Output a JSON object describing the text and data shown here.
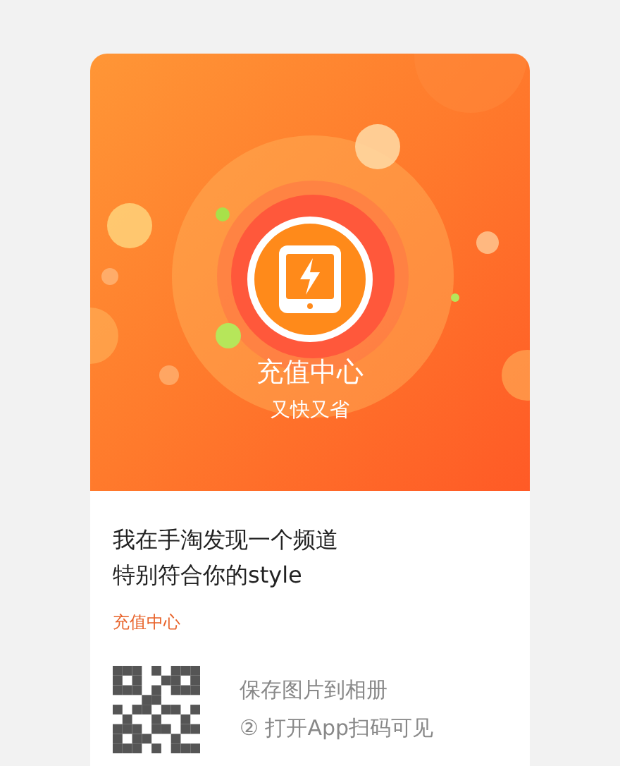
{
  "hero": {
    "title": "充值中心",
    "subtitle": "又快又省"
  },
  "share_text": [
    "我在手淘发现一个频道",
    "特别符合你的style"
  ],
  "channel_tag": "充值中心",
  "steps": [
    "保存图片到相册",
    "② 打开App扫码可见"
  ]
}
